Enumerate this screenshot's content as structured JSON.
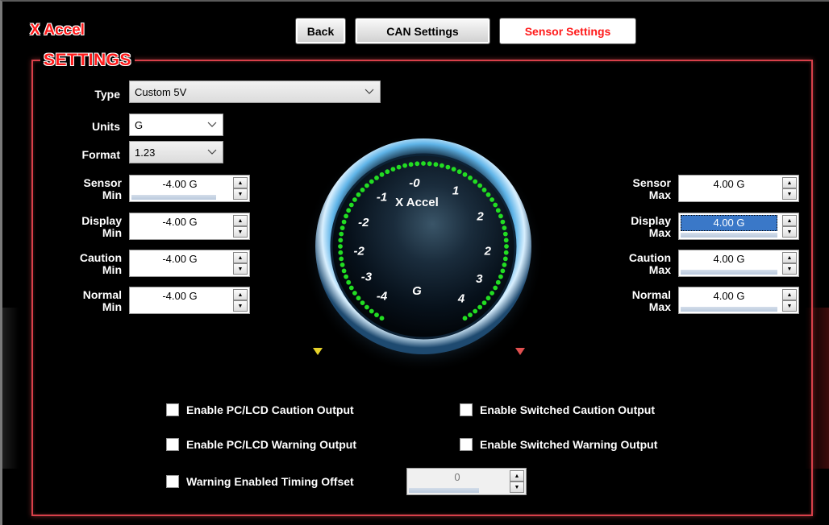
{
  "app": {
    "title": "X Accel"
  },
  "nav": {
    "back": "Back",
    "can_settings": "CAN Settings",
    "sensor_settings": "Sensor Settings"
  },
  "panel": {
    "title": "SETTINGS"
  },
  "fields": {
    "type": {
      "label": "Type",
      "value": "Custom 5V"
    },
    "units": {
      "label": "Units",
      "value": "G"
    },
    "format": {
      "label": "Format",
      "value": "1.23"
    }
  },
  "min_fields": [
    {
      "label_1": "Sensor",
      "label_2": "Min",
      "value": "-4.00 G",
      "fill": 0.85
    },
    {
      "label_1": "Display",
      "label_2": "Min",
      "value": "-4.00 G",
      "fill": 0.0
    },
    {
      "label_1": "Caution",
      "label_2": "Min",
      "value": "-4.00 G",
      "fill": 0.0
    },
    {
      "label_1": "Normal",
      "label_2": "Min",
      "value": "-4.00 G",
      "fill": 0.0
    }
  ],
  "max_fields": [
    {
      "label_1": "Sensor",
      "label_2": "Max",
      "value": "4.00 G",
      "fill": 0.0
    },
    {
      "label_1": "Display",
      "label_2": "Max",
      "value": "4.00 G",
      "fill": 0.97,
      "selected": true
    },
    {
      "label_1": "Caution",
      "label_2": "Max",
      "value": "4.00 G",
      "fill": 0.97
    },
    {
      "label_1": "Normal",
      "label_2": "Max",
      "value": "4.00 G",
      "fill": 0.97
    }
  ],
  "gauge": {
    "name": "X Accel",
    "unit": "G",
    "ticks_left": [
      "-0",
      "-1",
      "-2",
      "-2",
      "-3",
      "-4"
    ],
    "ticks_right": [
      "1",
      "2",
      "2",
      "3",
      "4"
    ],
    "dot_color": "#22dd22",
    "min_marker_color": "#e6d22a",
    "max_marker_color": "#e05050"
  },
  "checkboxes": {
    "pc_lcd_caution": {
      "label": "Enable PC/LCD Caution Output",
      "checked": false
    },
    "switched_caution": {
      "label": "Enable Switched Caution Output",
      "checked": false
    },
    "pc_lcd_warning": {
      "label": "Enable PC/LCD Warning Output",
      "checked": false
    },
    "switched_warning": {
      "label": "Enable Switched Warning Output",
      "checked": false
    },
    "warning_timing": {
      "label": "Warning Enabled Timing Offset",
      "checked": false
    }
  },
  "timing_offset": {
    "value": "0",
    "fill": 0.7
  }
}
